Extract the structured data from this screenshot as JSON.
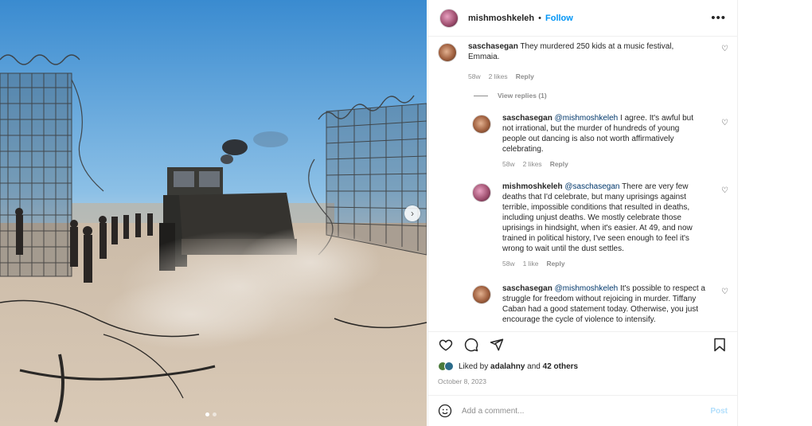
{
  "post": {
    "author": "mishmoshkeleh",
    "separator": "•",
    "follow_label": "Follow",
    "more_icon": "more-options-icon",
    "nav_arrow": "›"
  },
  "comments": [
    {
      "user": "saschasegan",
      "mention": "",
      "text": "They murdered 250 kids at a music festival, Emmaia.",
      "age": "58w",
      "likes": "2 likes",
      "reply": "Reply"
    },
    {
      "user": "saschasegan",
      "mention": "@mishmoshkeleh",
      "text": "I agree. It's awful but not irrational, but the murder of hundreds of young people out dancing is also not worth affirmatively celebrating.",
      "age": "58w",
      "likes": "2 likes",
      "reply": "Reply"
    },
    {
      "user": "mishmoshkeleh",
      "mention": "@saschasegan",
      "text": "There are very few deaths that I'd celebrate, but many uprisings against terrible, impossible conditions that resulted in deaths, including unjust deaths. We mostly celebrate those uprisings in hindsight, when it's easier. At 49, and now trained in political history, I've seen enough to feel it's wrong to wait until the dust settles.",
      "age": "58w",
      "likes": "1 like",
      "reply": "Reply"
    },
    {
      "user": "saschasegan",
      "mention": "@mishmoshkeleh",
      "text": "It's possible to respect a struggle for freedom without rejoicing in murder. Tiffany Caban had a good statement today. Otherwise, you just encourage the cycle of violence to intensify.",
      "age": "",
      "likes": "",
      "reply": ""
    }
  ],
  "view_replies": "View replies (1)",
  "likes_line": {
    "prefix": "Liked by",
    "user": "adalahny",
    "conj": "and",
    "others": "42 others"
  },
  "date": "October 8, 2023",
  "add_comment": {
    "placeholder": "Add a comment...",
    "post_label": "Post"
  },
  "colors": {
    "accent": "#0095f6",
    "mention": "#00376b",
    "muted": "#8e8e8e"
  }
}
